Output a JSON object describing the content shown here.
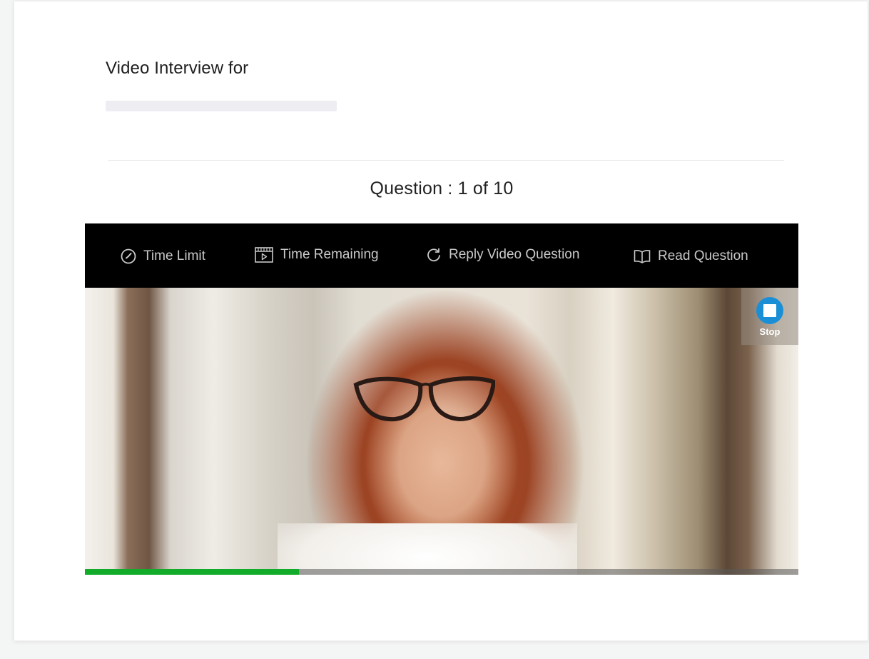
{
  "page": {
    "title": "Video Interview for",
    "question_counter": "Question : 1 of 10"
  },
  "toolbar": {
    "items": [
      {
        "label": "Time Limit",
        "icon": "clock-icon"
      },
      {
        "label": "Time Remaining",
        "icon": "video-clip-icon"
      },
      {
        "label": "Reply Video Question",
        "icon": "replay-icon"
      },
      {
        "label": "Read Question",
        "icon": "book-icon"
      }
    ]
  },
  "recorder": {
    "stop_label": "Stop",
    "stop_icon": "stop-icon",
    "progress_fraction": 0.3,
    "progress_color": "#13ac2a"
  },
  "colors": {
    "accent": "#1b8fd6",
    "toolbar_bg": "#000000",
    "toolbar_text": "#c9c9c9"
  }
}
